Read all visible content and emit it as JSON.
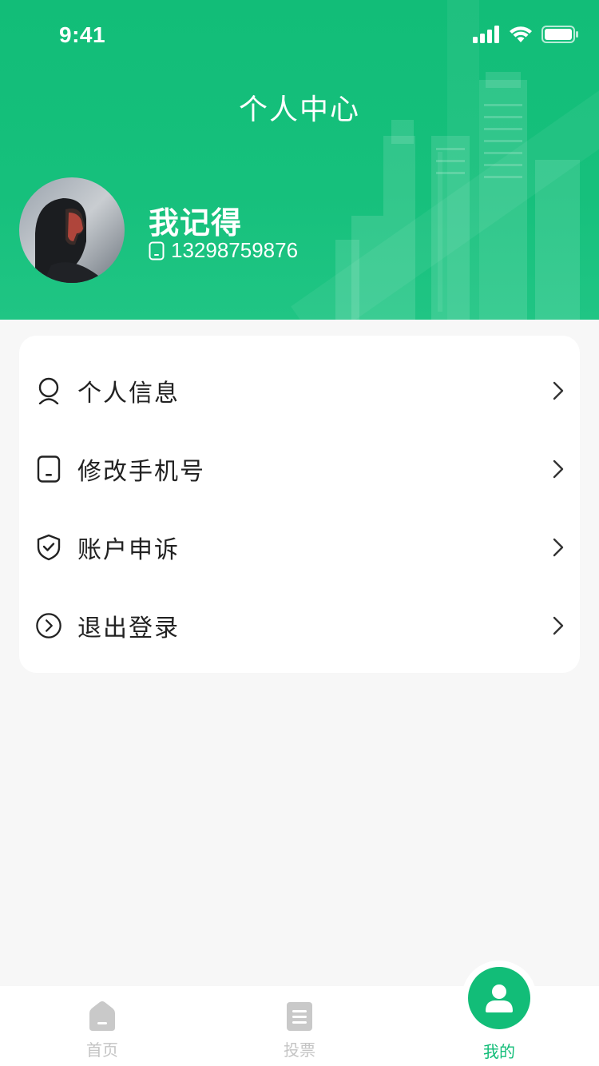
{
  "status_bar": {
    "time": "9:41"
  },
  "header": {
    "title": "个人中心"
  },
  "profile": {
    "name": "我记得",
    "phone": "13298759876"
  },
  "menu": [
    {
      "label": "个人信息",
      "icon": "user-icon"
    },
    {
      "label": "修改手机号",
      "icon": "phone-icon"
    },
    {
      "label": "账户申诉",
      "icon": "shield-check-icon"
    },
    {
      "label": "退出登录",
      "icon": "logout-circle-icon"
    }
  ],
  "tabbar": {
    "items": [
      {
        "label": "首页",
        "icon": "home-icon",
        "active": false
      },
      {
        "label": "投票",
        "icon": "document-icon",
        "active": false
      },
      {
        "label": "我的",
        "icon": "person-icon",
        "active": true
      }
    ]
  },
  "colors": {
    "brand": "#12bd78",
    "inactive": "#c4c4c4",
    "background": "#f7f7f7"
  }
}
